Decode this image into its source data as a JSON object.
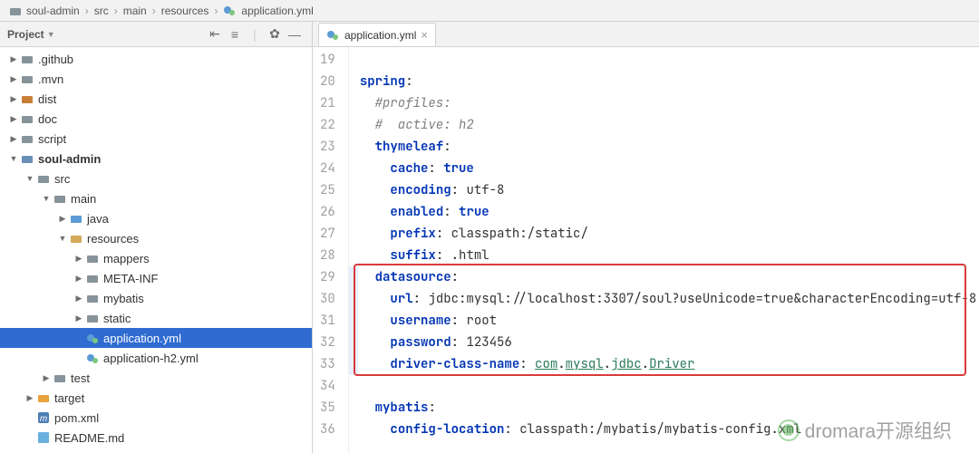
{
  "breadcrumb": [
    "soul-admin",
    "src",
    "main",
    "resources",
    "application.yml"
  ],
  "project_label": "Project",
  "tab_label": "application.yml",
  "tree": [
    {
      "d": 0,
      "ar": "r",
      "ic": "fold",
      "nm": ".github"
    },
    {
      "d": 0,
      "ar": "r",
      "ic": "fold",
      "nm": ".mvn"
    },
    {
      "d": 0,
      "ar": "r",
      "ic": "foldc",
      "nm": "dist"
    },
    {
      "d": 0,
      "ar": "r",
      "ic": "fold",
      "nm": "doc"
    },
    {
      "d": 0,
      "ar": "r",
      "ic": "fold",
      "nm": "script"
    },
    {
      "d": 0,
      "ar": "d",
      "ic": "foldb",
      "nm": "soul-admin",
      "bold": true
    },
    {
      "d": 1,
      "ar": "d",
      "ic": "fold",
      "nm": "src"
    },
    {
      "d": 2,
      "ar": "d",
      "ic": "fold",
      "nm": "main"
    },
    {
      "d": 3,
      "ar": "r",
      "ic": "foldj",
      "nm": "java"
    },
    {
      "d": 3,
      "ar": "d",
      "ic": "foldr",
      "nm": "resources"
    },
    {
      "d": 4,
      "ar": "r",
      "ic": "fold",
      "nm": "mappers"
    },
    {
      "d": 4,
      "ar": "r",
      "ic": "fold",
      "nm": "META-INF"
    },
    {
      "d": 4,
      "ar": "r",
      "ic": "fold",
      "nm": "mybatis"
    },
    {
      "d": 4,
      "ar": "r",
      "ic": "fold",
      "nm": "static"
    },
    {
      "d": 4,
      "ar": "",
      "ic": "yml",
      "nm": "application.yml",
      "sel": true
    },
    {
      "d": 4,
      "ar": "",
      "ic": "yml",
      "nm": "application-h2.yml"
    },
    {
      "d": 2,
      "ar": "r",
      "ic": "fold",
      "nm": "test"
    },
    {
      "d": 1,
      "ar": "r",
      "ic": "foldt",
      "nm": "target"
    },
    {
      "d": 1,
      "ar": "",
      "ic": "m",
      "nm": "pom.xml"
    },
    {
      "d": 1,
      "ar": "",
      "ic": "md",
      "nm": "README.md"
    }
  ],
  "code": [
    {
      "n": 19,
      "t": ""
    },
    {
      "n": 20,
      "t": "spring",
      "c": "k",
      "suf": ":"
    },
    {
      "n": 21,
      "t": "  #profiles:",
      "c": "cm"
    },
    {
      "n": 22,
      "t": "  #  active: h2",
      "c": "cm"
    },
    {
      "n": 23,
      "t": "  thymeleaf",
      "c": "k",
      "suf": ":"
    },
    {
      "n": 24,
      "t": "    cache",
      "c": "k",
      "suf": ": ",
      "val": "true",
      "vc": "lit"
    },
    {
      "n": 25,
      "t": "    encoding",
      "c": "k",
      "suf": ": ",
      "val": "utf-8",
      "vc": "v"
    },
    {
      "n": 26,
      "t": "    enabled",
      "c": "k",
      "suf": ": ",
      "val": "true",
      "vc": "lit"
    },
    {
      "n": 27,
      "t": "    prefix",
      "c": "k",
      "suf": ": ",
      "val": "classpath:/static/",
      "vc": "v"
    },
    {
      "n": 28,
      "t": "    suffix",
      "c": "k",
      "suf": ": ",
      "val": ".html",
      "vc": "v"
    },
    {
      "n": 29,
      "t": "  datasource",
      "c": "k",
      "suf": ":",
      "mk": true
    },
    {
      "n": 30,
      "t": "    url",
      "c": "k",
      "suf": ": ",
      "val": "jdbc:mysql://localhost:3307/soul?useUnicode=true&characterEncoding=utf-8",
      "vc": "v",
      "mk": true
    },
    {
      "n": 31,
      "t": "    username",
      "c": "k",
      "suf": ": ",
      "val": "root",
      "vc": "v",
      "mk": true
    },
    {
      "n": 32,
      "t": "    password",
      "c": "k",
      "suf": ": ",
      "val": "123456",
      "vc": "v",
      "mk": true
    },
    {
      "n": 33,
      "t": "    driver-class-name",
      "c": "k",
      "suf": ": ",
      "link": [
        "com",
        "mysql",
        "jdbc",
        "Driver"
      ],
      "mk": true
    },
    {
      "n": 34,
      "t": ""
    },
    {
      "n": 35,
      "t": "  mybatis",
      "c": "k",
      "suf": ":"
    },
    {
      "n": 36,
      "t": "    config-location",
      "c": "k",
      "suf": ": ",
      "val": "classpath:/mybatis/mybatis-config.xml",
      "vc": "v"
    }
  ],
  "highlight": {
    "start": 29,
    "end": 33
  },
  "watermark": "dromara开源组织"
}
